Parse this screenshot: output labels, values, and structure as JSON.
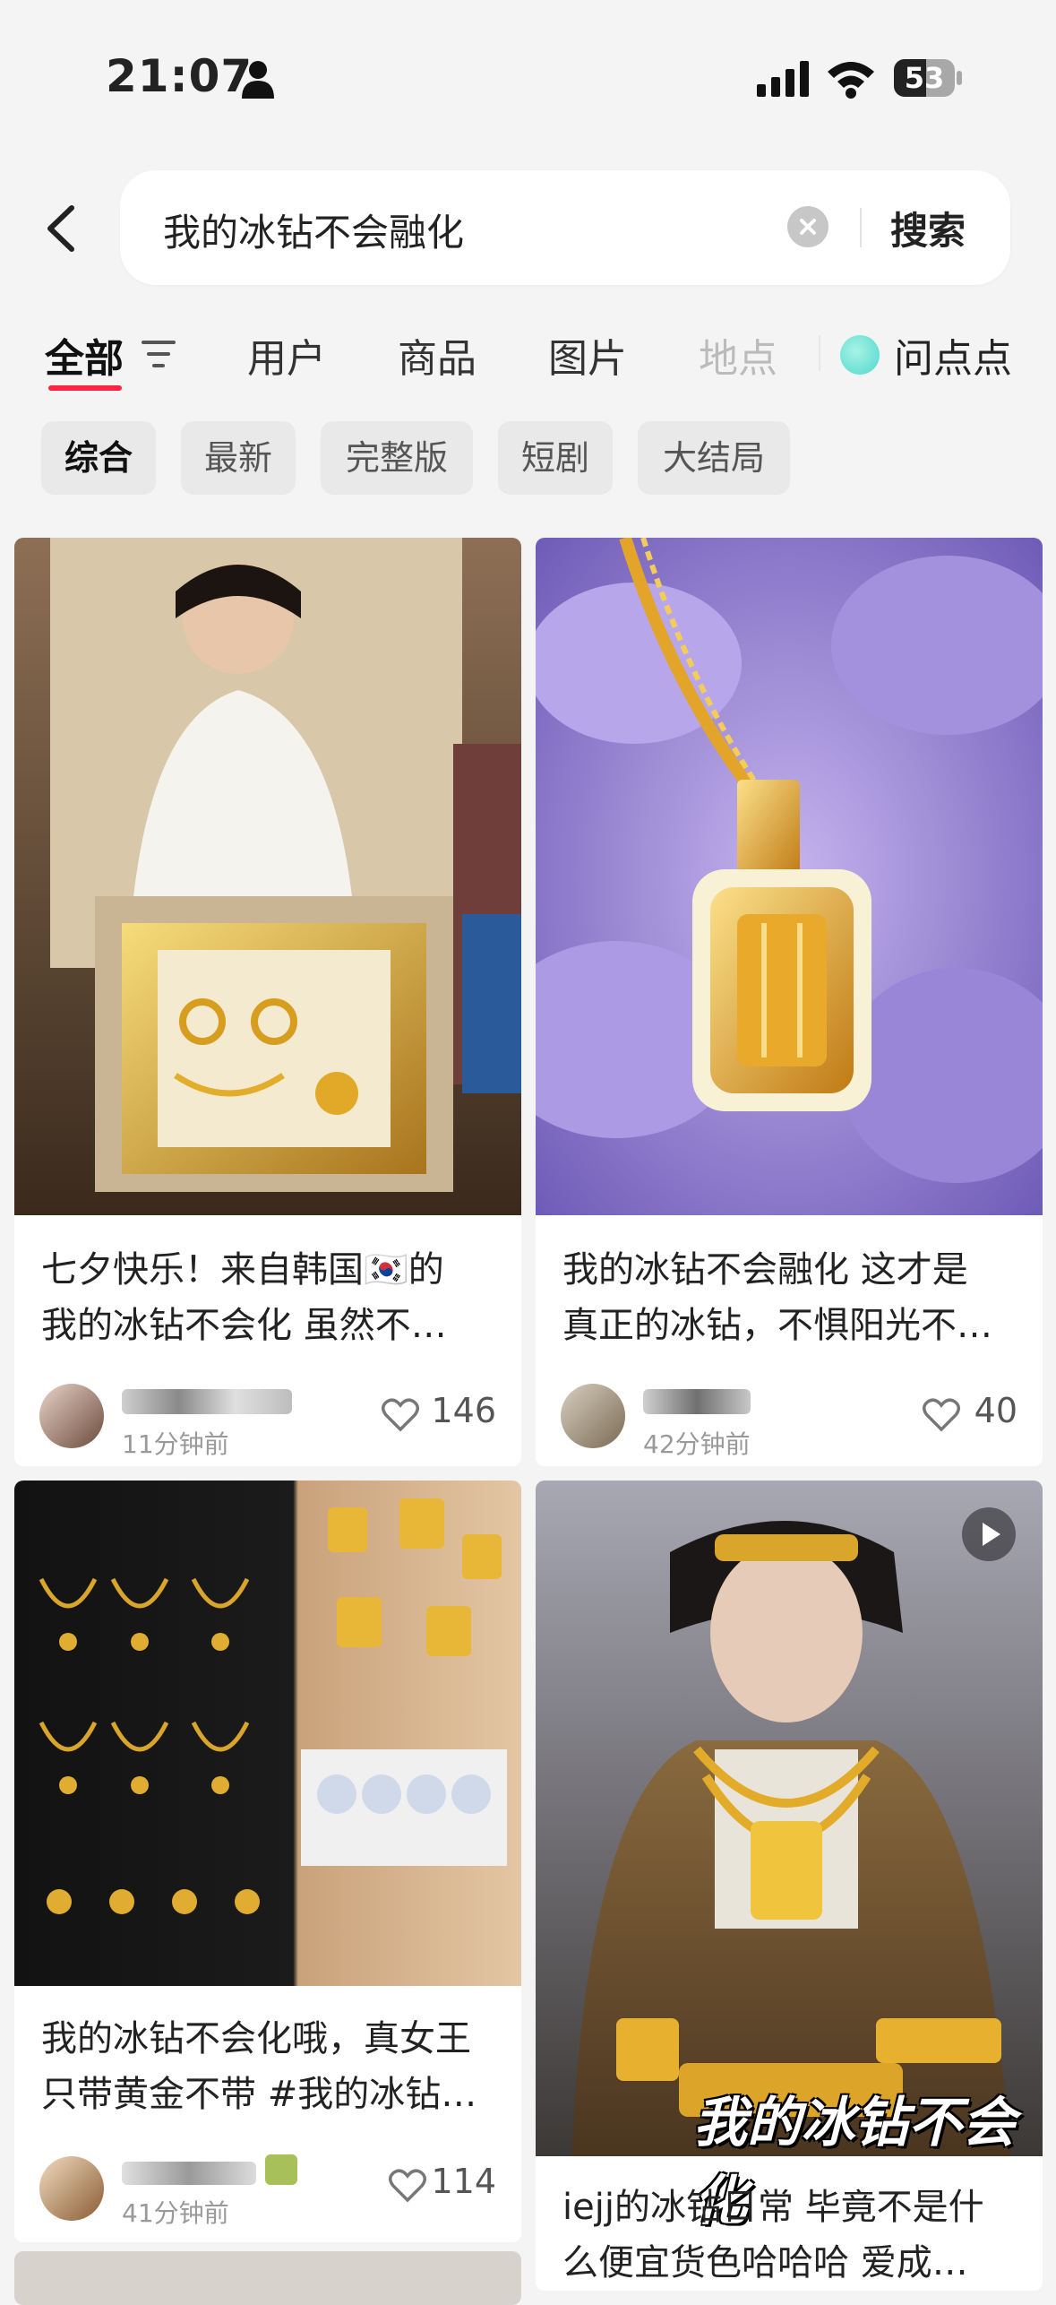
{
  "status": {
    "time": "21:07",
    "battery": "53",
    "battery_level": 0.53
  },
  "search": {
    "query": "我的冰钻不会融化",
    "submit_label": "搜索"
  },
  "tabs": [
    {
      "label": "全部"
    },
    {
      "label": "用户"
    },
    {
      "label": "商品"
    },
    {
      "label": "图片"
    },
    {
      "label": "地点"
    },
    {
      "label": "问点点"
    }
  ],
  "chips": [
    {
      "label": "综合"
    },
    {
      "label": "最新"
    },
    {
      "label": "完整版"
    },
    {
      "label": "短剧"
    },
    {
      "label": "大结局"
    }
  ],
  "cards": [
    {
      "title_line1": "七夕快乐！来自韩国🇰🇷的",
      "title_line2": "我的冰钻不会化 虽然不…",
      "time": "11分钟前",
      "likes": "146",
      "image_icon": "photo-jewelry-box"
    },
    {
      "title_line1": "我的冰钻不会融化 这才是",
      "title_line2": "真正的冰钻，不惧阳光不…",
      "time": "42分钟前",
      "likes": "40",
      "image_icon": "photo-pendant"
    },
    {
      "title_line1": "我的冰钻不会化哦，真女王",
      "title_line2": "只带黄金不带 #我的冰钻…",
      "time": "41分钟前",
      "likes": "114",
      "image_icon": "photo-gold-collection"
    },
    {
      "title_line1": "iejj的冰钻日常 毕竟不是什",
      "title_line2": "么便宜货色哈哈哈 爱成…",
      "overlay_caption": "我的冰钻不会化",
      "image_icon": "photo-doll-video"
    }
  ],
  "colors": {
    "accent": "#ff2442",
    "background": "#f4f4f4"
  }
}
